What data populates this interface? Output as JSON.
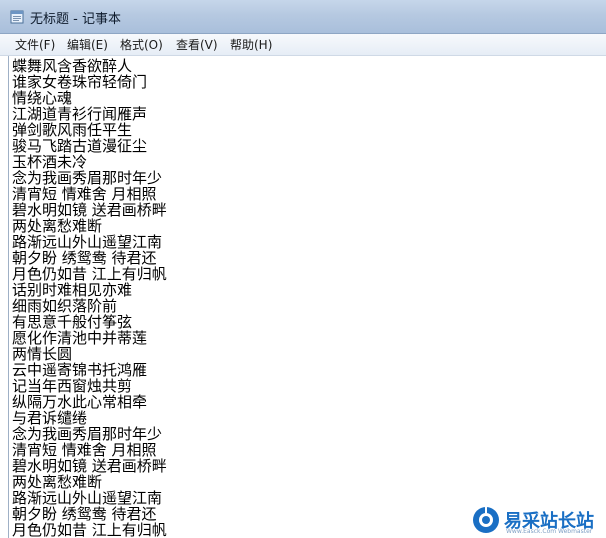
{
  "window": {
    "title": "无标题 - 记事本",
    "icon": "notepad-icon"
  },
  "menu": [
    {
      "label": "文件(F)"
    },
    {
      "label": "编辑(E)"
    },
    {
      "label": "格式(O)"
    },
    {
      "label": "查看(V)"
    },
    {
      "label": "帮助(H)"
    }
  ],
  "editor": {
    "lines": [
      "蝶舞风含香欲醉人",
      "谁家女卷珠帘轻倚门",
      "情绕心魂",
      "江湖道青衫行闻雁声",
      "弹剑歌风雨任平生",
      "骏马飞踏古道漫征尘",
      "玉杯酒未冷",
      "念为我画秀眉那时年少",
      "清宵短 情难舍 月相照",
      "碧水明如镜 送君画桥畔",
      "两处离愁难断",
      "路渐远山外山遥望江南",
      "朝夕盼 绣鸳鸯 待君还",
      "月色仍如昔 江上有归帆",
      "话别时难相见亦难",
      "细雨如织落阶前",
      "有思意千般付筝弦",
      "愿化作清池中并蒂莲",
      "两情长圆",
      "云中遥寄锦书托鸿雁",
      "记当年西窗烛共剪",
      "纵隔万水此心常相牵",
      "与君诉缱绻",
      "念为我画秀眉那时年少",
      "清宵短 情难舍 月相照",
      "碧水明如镜 送君画桥畔",
      "两处离愁难断",
      "路渐远山外山遥望江南",
      "朝夕盼 绣鸳鸯 待君还",
      "月色仍如昔 江上有归帆"
    ]
  },
  "watermark": {
    "text": "易采站长站",
    "sub": "Www.Easck.Com Webmaster",
    "icon": "easck-logo-icon",
    "color": "#1a6fc4"
  }
}
